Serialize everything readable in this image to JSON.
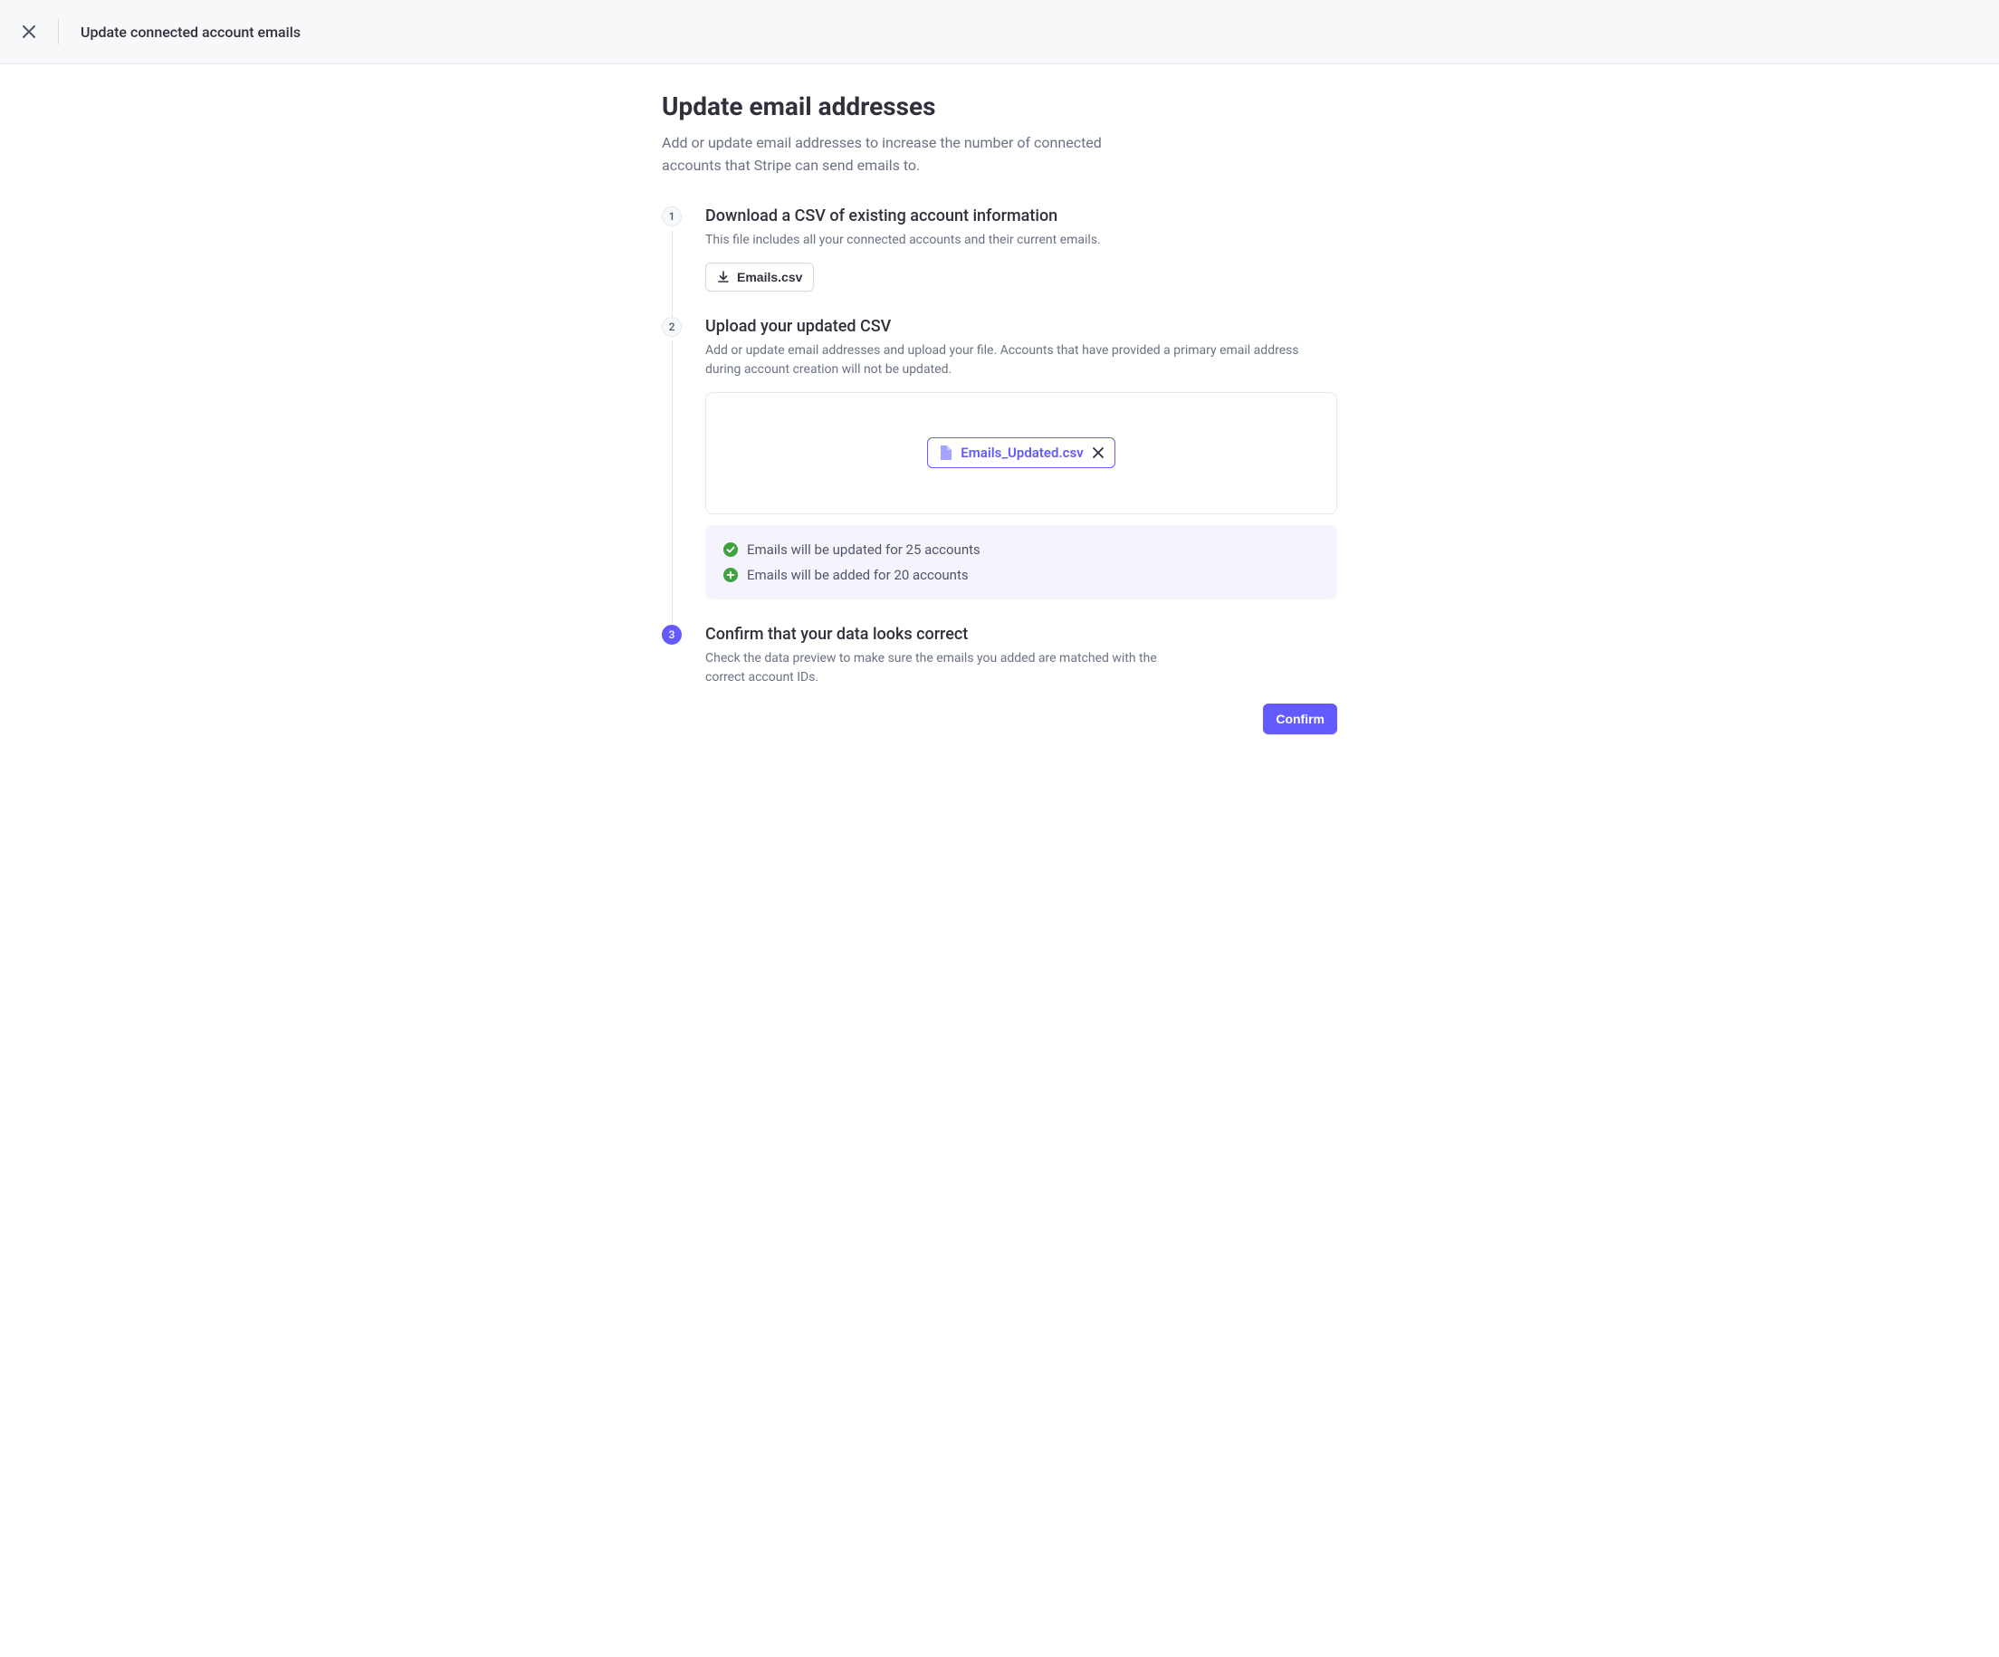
{
  "header": {
    "title": "Update connected account emails"
  },
  "page": {
    "title": "Update email addresses",
    "subtitle": "Add or update email addresses to increase the number of connected accounts that Stripe can send emails to."
  },
  "steps": {
    "s1": {
      "num": "1",
      "title": "Download a CSV of existing account information",
      "desc": "This file includes all your connected accounts and their current emails.",
      "download_label": "Emails.csv"
    },
    "s2": {
      "num": "2",
      "title": "Upload your updated CSV",
      "desc": "Add or update email addresses and upload your file. Accounts that have provided a primary email address during account creation will not be updated.",
      "uploaded_file": "Emails_Updated.csv",
      "status_updated": "Emails will be updated for 25 accounts",
      "status_added": "Emails will be added for 20 accounts"
    },
    "s3": {
      "num": "3",
      "title": "Confirm that your data looks correct",
      "desc": "Check the data preview to make sure the emails you added are matched with the correct account IDs.",
      "confirm_label": "Confirm"
    }
  }
}
